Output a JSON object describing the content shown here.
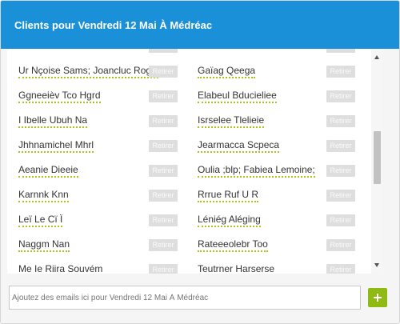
{
  "header": {
    "title": "Clients pour Vendredi 12 Mai À Médréac"
  },
  "remove_label": "Retirer",
  "rows": [
    {
      "left": "",
      "right": ""
    },
    {
      "left": "Ur Nçoise Sams; Joancluc Rogeru",
      "right": "Gaïag Qeega"
    },
    {
      "left": "Ggneeièv Tco Hgrd",
      "right": "Elabeul Bducieliee"
    },
    {
      "left": "I Ibelle Ubuh Na",
      "right": "Isrselee Tlelieie"
    },
    {
      "left": "Jhhnamichel Mhrl",
      "right": "Jearmacca Scpeca"
    },
    {
      "left": "Aeanie Dieeie",
      "right": "Oulia ;blp; Fabiea Lemoine;"
    },
    {
      "left": "Karnnk Knn",
      "right": "Rrrue Ruf U R"
    },
    {
      "left": "Leï Le Cï Ï",
      "right": "Léniég Aléging"
    },
    {
      "left": "Naggm Nan",
      "right": "Rateeeolebr Too"
    },
    {
      "left": "Me Ie Riira Souvém",
      "right": "Teutrner Harserse"
    }
  ],
  "footer": {
    "email_placeholder": "Ajoutez des emails ici pour Vendredi 12 Mai À Médréac"
  },
  "colors": {
    "header_bg": "#1a90d9",
    "underline": "#a5c71b",
    "add_button": "#8fba14"
  },
  "icons": {
    "add": "plus-icon",
    "scroll_up": "chevron-up-icon",
    "scroll_down": "chevron-down-icon"
  }
}
